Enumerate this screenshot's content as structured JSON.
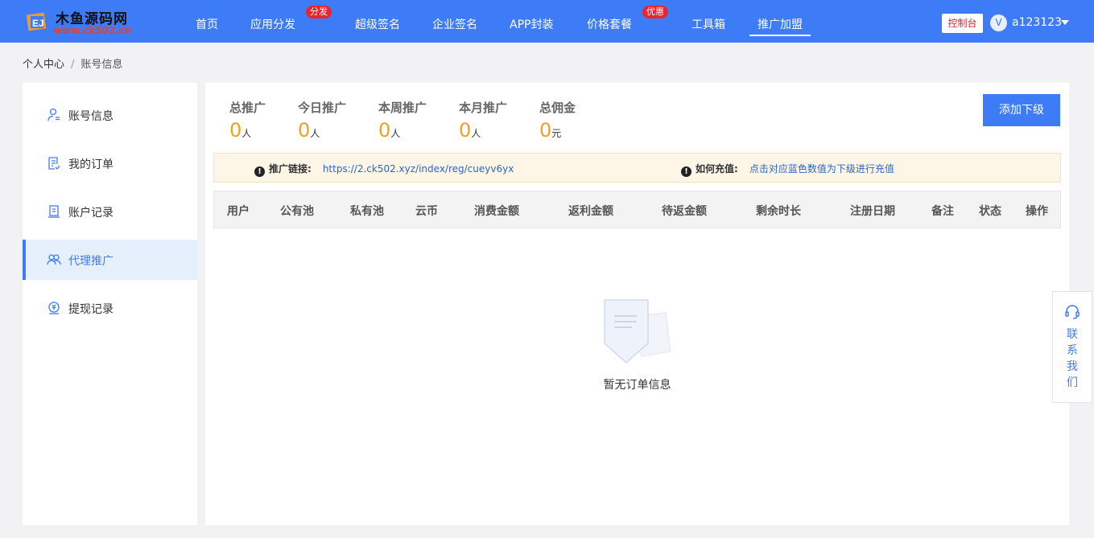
{
  "brand": {
    "name": "木鱼源码网",
    "url": "www.ck502.cn"
  },
  "nav": {
    "items": [
      {
        "label": "首页"
      },
      {
        "label": "应用分发",
        "badge": "分发"
      },
      {
        "label": "超级签名"
      },
      {
        "label": "企业签名"
      },
      {
        "label": "APP封装"
      },
      {
        "label": "价格套餐",
        "badge": "优惠"
      },
      {
        "label": "工具箱"
      },
      {
        "label": "推广加盟",
        "active": true
      }
    ],
    "console_label": "控制台",
    "avatar_letter": "V",
    "username": "a123123"
  },
  "breadcrumb": {
    "root": "个人中心",
    "separator": "/",
    "current": "账号信息"
  },
  "sidebar": {
    "items": [
      {
        "label": "账号信息",
        "icon": "user-icon"
      },
      {
        "label": "我的订单",
        "icon": "order-icon"
      },
      {
        "label": "账户记录",
        "icon": "record-icon"
      },
      {
        "label": "代理推广",
        "icon": "agent-icon",
        "active": true
      },
      {
        "label": "提现记录",
        "icon": "withdraw-icon"
      }
    ]
  },
  "stats": [
    {
      "label": "总推广",
      "value": "0",
      "unit": "人"
    },
    {
      "label": "今日推广",
      "value": "0",
      "unit": "人"
    },
    {
      "label": "本周推广",
      "value": "0",
      "unit": "人"
    },
    {
      "label": "本月推广",
      "value": "0",
      "unit": "人"
    },
    {
      "label": "总佣金",
      "value": "0",
      "unit": "元"
    }
  ],
  "add_button": "添加下级",
  "notice": {
    "link_title": "推广链接:",
    "link_url": "https://2.ck502.xyz/index/reg/cueyv6yx",
    "recharge_title": "如何充值:",
    "recharge_text": "点击对应蓝色数值为下级进行充值",
    "icon": "!"
  },
  "table": {
    "columns": [
      "用户",
      "公有池",
      "私有池",
      "云币",
      "消费金额",
      "返利金额",
      "待返金额",
      "剩余时长",
      "注册日期",
      "备注",
      "状态",
      "操作"
    ],
    "empty_text": "暂无订单信息"
  },
  "contact": {
    "label": "联系我们"
  },
  "colors": {
    "primary": "#3d7bf7",
    "accent_number": "#f5a018",
    "badge_red": "#e8262f",
    "notice_bg": "#fdf5e6"
  }
}
